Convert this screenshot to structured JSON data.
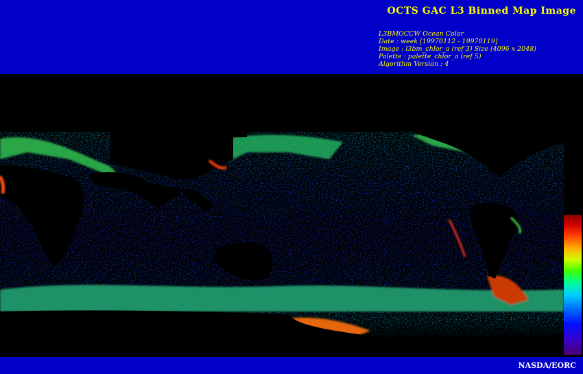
{
  "header": {
    "title": "OCTS GAC L3 Binned Map Image",
    "meta": [
      "L3BMOCCW Ocean Color",
      "Date : week [19970112 - 19970119]",
      "Image : l3bm_chlor_a (ref 3) Size (4096 x 2048)",
      "Palette : palette_chlor_a (ref 5)",
      "Algorithm Version : 4"
    ]
  },
  "footer": {
    "credit": "NASDA/EORC"
  },
  "colors": {
    "header_bg": "#0000c8",
    "title_text": "#ffff00",
    "credit_text": "#ffffff",
    "land": "#000000",
    "ocean_low": "#1a28c8",
    "ocean_mid": "#10a0c0",
    "ocean_high": "#30d040",
    "bloom": "#ff6000"
  },
  "map": {
    "layer": "chlorophyll-a concentration",
    "colorbar_palette": [
      "#4b006e",
      "#0010ff",
      "#00d0ff",
      "#40ff00",
      "#ffb000",
      "#d00000",
      "#8a0000"
    ]
  }
}
